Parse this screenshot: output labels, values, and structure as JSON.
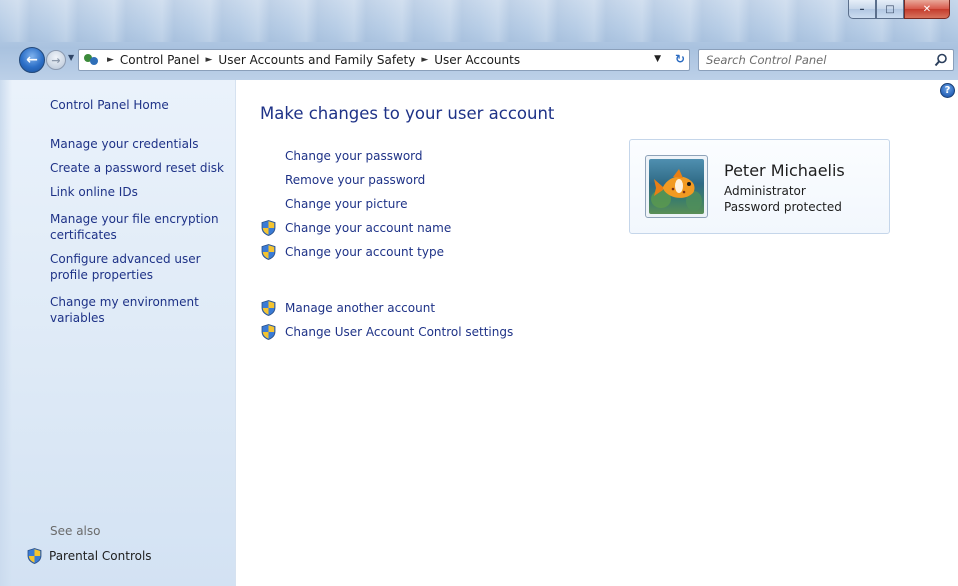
{
  "window": {
    "controls": {
      "minimize": "–",
      "maximize": "□",
      "close": "✕"
    }
  },
  "nav": {
    "back_icon": "back-arrow-icon",
    "forward_icon": "forward-arrow-icon",
    "breadcrumb": [
      "Control Panel",
      "User Accounts and Family Safety",
      "User Accounts"
    ],
    "search_placeholder": "Search Control Panel"
  },
  "sidebar": {
    "home": "Control Panel Home",
    "links": [
      "Manage your credentials",
      "Create a password reset disk",
      "Link online IDs",
      "Manage your file encryption certificates",
      "Configure advanced user profile properties",
      "Change my environment variables"
    ],
    "see_also": "See also",
    "parental_controls": "Parental Controls"
  },
  "main": {
    "title": "Make changes to your user account",
    "tasks": [
      {
        "label": "Change your password",
        "shield": false
      },
      {
        "label": "Remove your password",
        "shield": false
      },
      {
        "label": "Change your picture",
        "shield": false
      },
      {
        "label": "Change your account name",
        "shield": true
      },
      {
        "label": "Change your account type",
        "shield": true
      }
    ],
    "other_tasks": [
      {
        "label": "Manage another account",
        "shield": true
      },
      {
        "label": "Change User Account Control settings",
        "shield": true
      }
    ]
  },
  "account": {
    "name": "Peter Michaelis",
    "role": "Administrator",
    "status": "Password protected"
  },
  "colors": {
    "link": "#1e3287",
    "sidebar_bg": "#dde9f6",
    "card_border": "#c5d6ea"
  }
}
